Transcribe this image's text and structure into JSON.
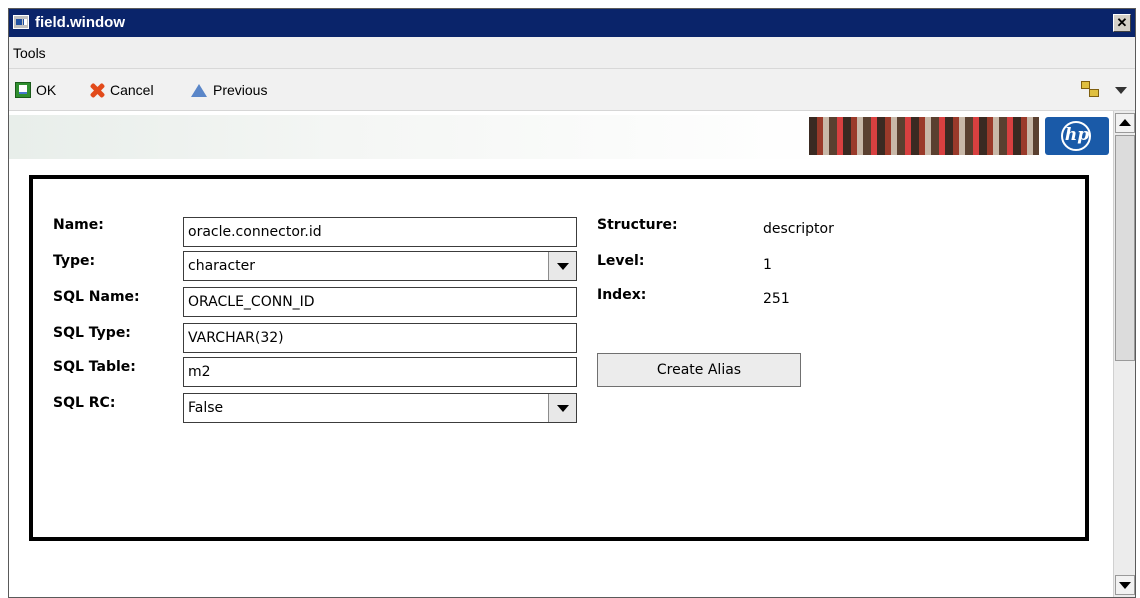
{
  "window": {
    "title": "field.window",
    "close_label": "✕"
  },
  "menu": {
    "items": [
      {
        "label": "Tools"
      }
    ]
  },
  "toolbar": {
    "ok_label": "OK",
    "cancel_label": "Cancel",
    "previous_label": "Previous",
    "icons": {
      "ok": "save-icon",
      "cancel": "cancel-x-icon",
      "previous": "previous-triangle-icon",
      "options": "tree-options-icon",
      "dropdown": "chevron-down-icon"
    }
  },
  "banner": {
    "logo_text": "hp"
  },
  "form": {
    "name_label": "Name:",
    "name_value": "oracle.connector.id",
    "type_label": "Type:",
    "type_value": "character",
    "sql_name_label": "SQL Name:",
    "sql_name_value": "ORACLE_CONN_ID",
    "sql_type_label": "SQL Type:",
    "sql_type_value": "VARCHAR(32)",
    "sql_table_label": "SQL Table:",
    "sql_table_value": "m2",
    "sql_rc_label": "SQL RC:",
    "sql_rc_value": "False",
    "structure_label": "Structure:",
    "structure_value": "descriptor",
    "level_label": "Level:",
    "level_value": "1",
    "index_label": "Index:",
    "index_value": "251",
    "create_alias_label": "Create Alias"
  },
  "colors": {
    "titlebar": "#0a246a",
    "toolbar": "#f1f1f1",
    "hp_blue": "#1a5aa8"
  }
}
